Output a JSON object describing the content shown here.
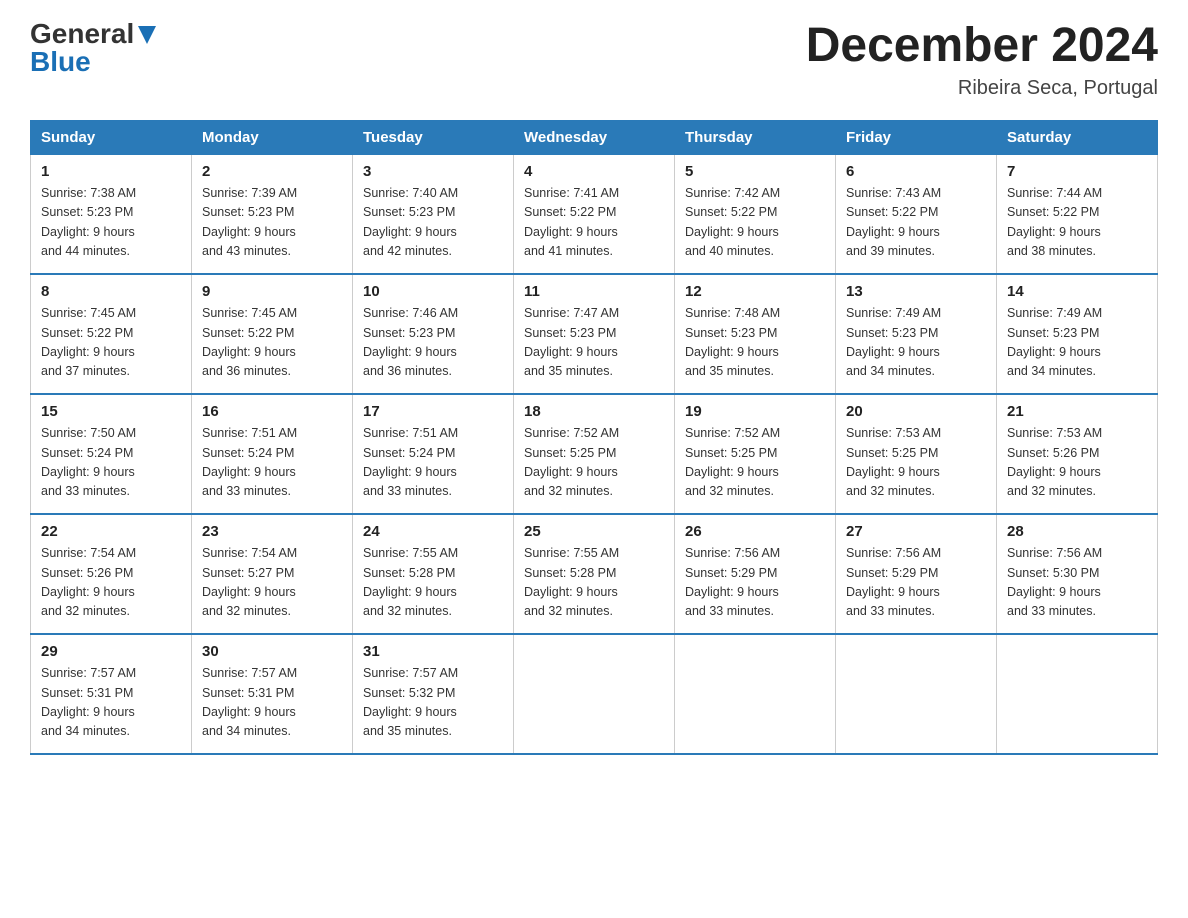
{
  "header": {
    "logo_general": "General",
    "logo_blue": "Blue",
    "month_title": "December 2024",
    "location": "Ribeira Seca, Portugal"
  },
  "days_of_week": [
    "Sunday",
    "Monday",
    "Tuesday",
    "Wednesday",
    "Thursday",
    "Friday",
    "Saturday"
  ],
  "weeks": [
    [
      {
        "day": "1",
        "sunrise": "7:38 AM",
        "sunset": "5:23 PM",
        "daylight": "9 hours and 44 minutes."
      },
      {
        "day": "2",
        "sunrise": "7:39 AM",
        "sunset": "5:23 PM",
        "daylight": "9 hours and 43 minutes."
      },
      {
        "day": "3",
        "sunrise": "7:40 AM",
        "sunset": "5:23 PM",
        "daylight": "9 hours and 42 minutes."
      },
      {
        "day": "4",
        "sunrise": "7:41 AM",
        "sunset": "5:22 PM",
        "daylight": "9 hours and 41 minutes."
      },
      {
        "day": "5",
        "sunrise": "7:42 AM",
        "sunset": "5:22 PM",
        "daylight": "9 hours and 40 minutes."
      },
      {
        "day": "6",
        "sunrise": "7:43 AM",
        "sunset": "5:22 PM",
        "daylight": "9 hours and 39 minutes."
      },
      {
        "day": "7",
        "sunrise": "7:44 AM",
        "sunset": "5:22 PM",
        "daylight": "9 hours and 38 minutes."
      }
    ],
    [
      {
        "day": "8",
        "sunrise": "7:45 AM",
        "sunset": "5:22 PM",
        "daylight": "9 hours and 37 minutes."
      },
      {
        "day": "9",
        "sunrise": "7:45 AM",
        "sunset": "5:22 PM",
        "daylight": "9 hours and 36 minutes."
      },
      {
        "day": "10",
        "sunrise": "7:46 AM",
        "sunset": "5:23 PM",
        "daylight": "9 hours and 36 minutes."
      },
      {
        "day": "11",
        "sunrise": "7:47 AM",
        "sunset": "5:23 PM",
        "daylight": "9 hours and 35 minutes."
      },
      {
        "day": "12",
        "sunrise": "7:48 AM",
        "sunset": "5:23 PM",
        "daylight": "9 hours and 35 minutes."
      },
      {
        "day": "13",
        "sunrise": "7:49 AM",
        "sunset": "5:23 PM",
        "daylight": "9 hours and 34 minutes."
      },
      {
        "day": "14",
        "sunrise": "7:49 AM",
        "sunset": "5:23 PM",
        "daylight": "9 hours and 34 minutes."
      }
    ],
    [
      {
        "day": "15",
        "sunrise": "7:50 AM",
        "sunset": "5:24 PM",
        "daylight": "9 hours and 33 minutes."
      },
      {
        "day": "16",
        "sunrise": "7:51 AM",
        "sunset": "5:24 PM",
        "daylight": "9 hours and 33 minutes."
      },
      {
        "day": "17",
        "sunrise": "7:51 AM",
        "sunset": "5:24 PM",
        "daylight": "9 hours and 33 minutes."
      },
      {
        "day": "18",
        "sunrise": "7:52 AM",
        "sunset": "5:25 PM",
        "daylight": "9 hours and 32 minutes."
      },
      {
        "day": "19",
        "sunrise": "7:52 AM",
        "sunset": "5:25 PM",
        "daylight": "9 hours and 32 minutes."
      },
      {
        "day": "20",
        "sunrise": "7:53 AM",
        "sunset": "5:25 PM",
        "daylight": "9 hours and 32 minutes."
      },
      {
        "day": "21",
        "sunrise": "7:53 AM",
        "sunset": "5:26 PM",
        "daylight": "9 hours and 32 minutes."
      }
    ],
    [
      {
        "day": "22",
        "sunrise": "7:54 AM",
        "sunset": "5:26 PM",
        "daylight": "9 hours and 32 minutes."
      },
      {
        "day": "23",
        "sunrise": "7:54 AM",
        "sunset": "5:27 PM",
        "daylight": "9 hours and 32 minutes."
      },
      {
        "day": "24",
        "sunrise": "7:55 AM",
        "sunset": "5:28 PM",
        "daylight": "9 hours and 32 minutes."
      },
      {
        "day": "25",
        "sunrise": "7:55 AM",
        "sunset": "5:28 PM",
        "daylight": "9 hours and 32 minutes."
      },
      {
        "day": "26",
        "sunrise": "7:56 AM",
        "sunset": "5:29 PM",
        "daylight": "9 hours and 33 minutes."
      },
      {
        "day": "27",
        "sunrise": "7:56 AM",
        "sunset": "5:29 PM",
        "daylight": "9 hours and 33 minutes."
      },
      {
        "day": "28",
        "sunrise": "7:56 AM",
        "sunset": "5:30 PM",
        "daylight": "9 hours and 33 minutes."
      }
    ],
    [
      {
        "day": "29",
        "sunrise": "7:57 AM",
        "sunset": "5:31 PM",
        "daylight": "9 hours and 34 minutes."
      },
      {
        "day": "30",
        "sunrise": "7:57 AM",
        "sunset": "5:31 PM",
        "daylight": "9 hours and 34 minutes."
      },
      {
        "day": "31",
        "sunrise": "7:57 AM",
        "sunset": "5:32 PM",
        "daylight": "9 hours and 35 minutes."
      },
      null,
      null,
      null,
      null
    ]
  ],
  "labels": {
    "sunrise": "Sunrise: ",
    "sunset": "Sunset: ",
    "daylight": "Daylight: "
  }
}
